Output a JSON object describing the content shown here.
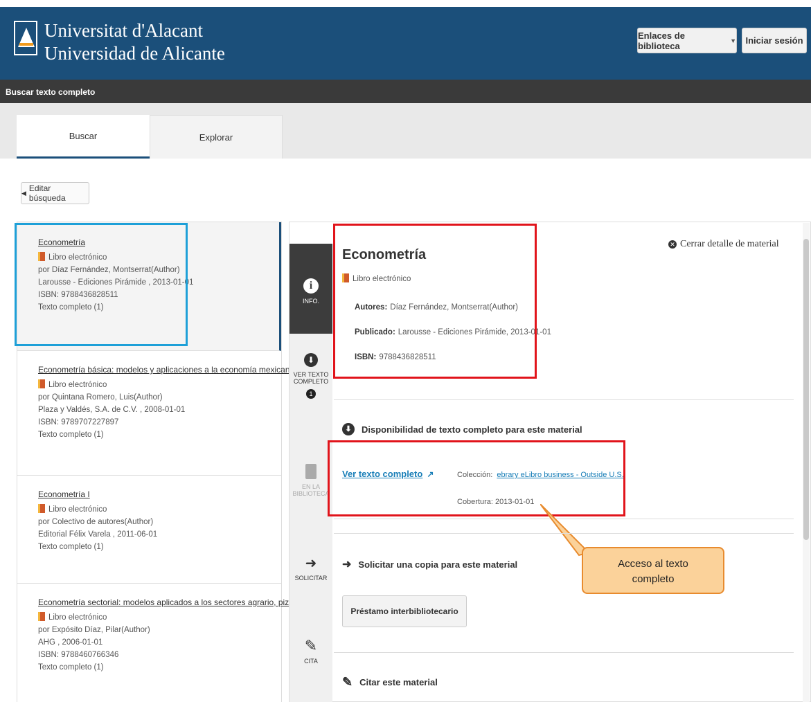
{
  "header": {
    "university_name_line1": "Universitat d'Alacant",
    "university_name_line2": "Universidad de Alicante",
    "links_button": "Enlaces de biblioteca",
    "login_button": "Iniciar sesión"
  },
  "subbar": {
    "title": "Buscar texto completo"
  },
  "tabs": [
    {
      "label": "Buscar"
    },
    {
      "label": "Explorar"
    }
  ],
  "edit_search": "Editar búsqueda",
  "results": [
    {
      "title": "Econometría",
      "type": "Libro electrónico",
      "author": "por Díaz Fernández, Montserrat(Author)",
      "publisher": "Larousse - Ediciones Pirámide , 2013-01-01",
      "isbn": "ISBN: 9788436828511",
      "fulltext": "Texto completo (1)"
    },
    {
      "title": "Econometría básica: modelos y aplicaciones a la economía mexicana",
      "type": "Libro electrónico",
      "author": "por Quintana Romero, Luis(Author)",
      "publisher": "Plaza y Valdés, S.A. de C.V. , 2008-01-01",
      "isbn": "ISBN: 9789707227897",
      "fulltext": "Texto completo (1)"
    },
    {
      "title": "Econometría I",
      "type": "Libro electrónico",
      "author": "por Colectivo de autores(Author)",
      "publisher": "Editorial Félix Varela , 2011-06-01",
      "fulltext": "Texto completo (1)"
    },
    {
      "title": "Econometría sectorial: modelos aplicados a los sectores agrario, pizarra,...",
      "type": "Libro electrónico",
      "author": "por Expósito Díaz, Pilar(Author)",
      "publisher": "AHG , 2006-01-01",
      "isbn": "ISBN: 9788460766346",
      "fulltext": "Texto completo (1)"
    }
  ],
  "sidenav": {
    "info": "INFO.",
    "fulltext_line1": "VER TEXTO",
    "fulltext_line2": "COMPLETO",
    "fulltext_badge": "1",
    "library_line1": "EN LA",
    "library_line2": "BIBLIOTECA",
    "request": "SOLICITAR",
    "cite": "CITA"
  },
  "detail": {
    "close_label": "Cerrar detalle de material",
    "title": "Econometría",
    "type": "Libro electrónico",
    "authors_label": "Autores:",
    "authors_value": "Díaz Fernández, Montserrat(Author)",
    "published_label": "Publicado:",
    "published_value": "Larousse - Ediciones Pirámide, 2013-01-01",
    "isbn_label": "ISBN:",
    "isbn_value": "9788436828511",
    "availability_heading": "Disponibilidad de texto completo para este material",
    "fulltext_link": "Ver texto completo",
    "collection_label": "Colección:",
    "collection_value": "ebrary eLibro business - Outside U.S.",
    "coverage_label": "Cobertura:",
    "coverage_value": "2013-01-01",
    "request_heading": "Solicitar una copia para este material",
    "loan_button": "Préstamo interbibliotecario",
    "cite_heading": "Citar este material"
  },
  "callout": {
    "line1": "Acceso al texto",
    "line2": "completo"
  },
  "colors": {
    "brand": "#1b4f7a",
    "highlight_blue": "#1ea0d8",
    "highlight_red": "#e1141b",
    "callout_fill": "#fbd29a",
    "link": "#1a7fb8"
  }
}
